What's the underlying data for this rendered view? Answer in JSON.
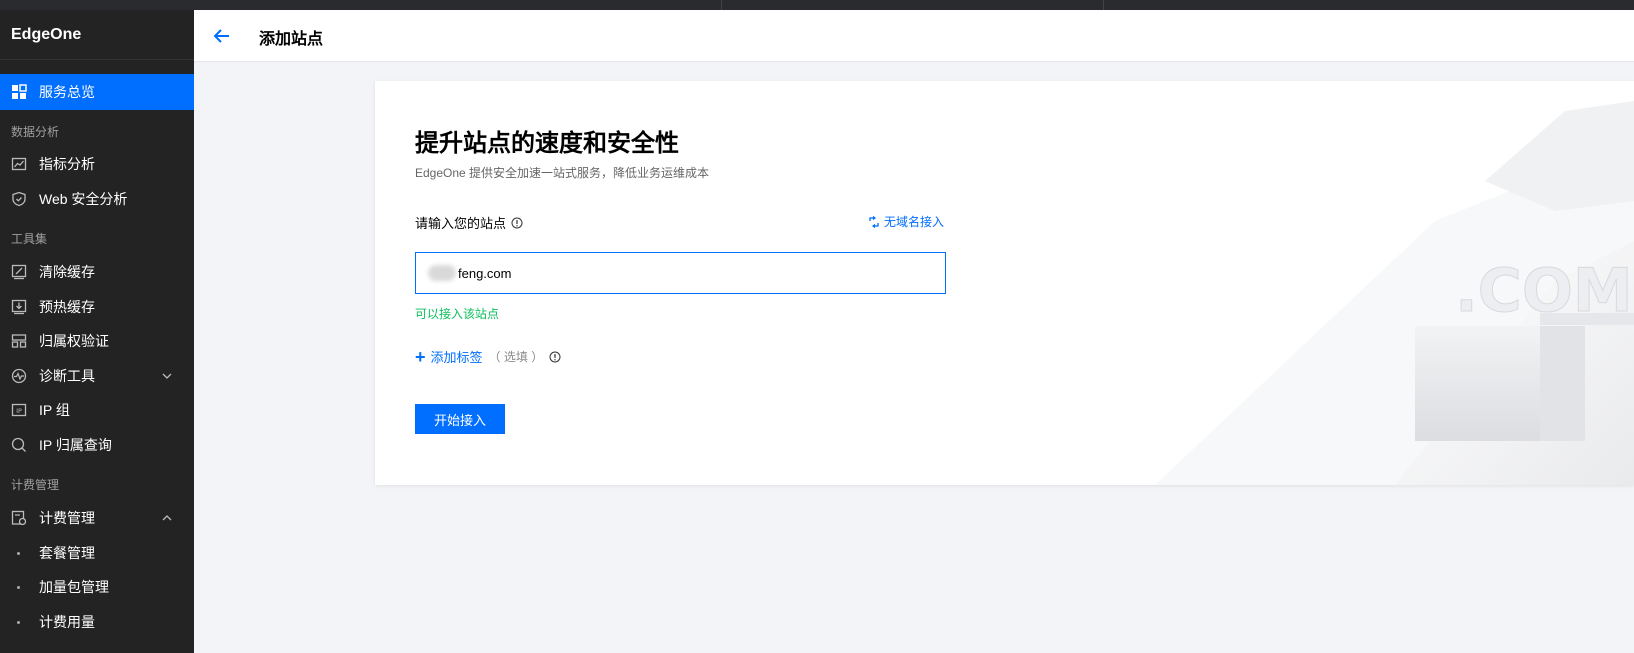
{
  "app": {
    "brand": "EdgeOne"
  },
  "header": {
    "title": "添加站点"
  },
  "sidebar": {
    "items": [
      {
        "label": "服务总览",
        "icon": "grid-icon",
        "active": true
      },
      {
        "section": "数据分析"
      },
      {
        "label": "指标分析",
        "icon": "chart-icon"
      },
      {
        "label": "Web 安全分析",
        "icon": "shield-icon"
      },
      {
        "section": "工具集"
      },
      {
        "label": "清除缓存",
        "icon": "clear-cache-icon"
      },
      {
        "label": "预热缓存",
        "icon": "download-icon"
      },
      {
        "label": "归属权验证",
        "icon": "verify-icon"
      },
      {
        "label": "诊断工具",
        "icon": "pulse-icon",
        "expandable": true,
        "expanded": false
      },
      {
        "label": "IP 组",
        "icon": "ip-icon"
      },
      {
        "label": "IP 归属查询",
        "icon": "search-icon"
      },
      {
        "section": "计费管理"
      },
      {
        "label": "计费管理",
        "icon": "billing-icon",
        "expandable": true,
        "expanded": true
      },
      {
        "label": "套餐管理",
        "sub": true
      },
      {
        "label": "加量包管理",
        "sub": true
      },
      {
        "label": "计费用量",
        "sub": true
      }
    ]
  },
  "card": {
    "heading": "提升站点的速度和安全性",
    "subtitle": "EdgeOne 提供安全加速一站式服务，降低业务运维成本",
    "field_label": "请输入您的站点",
    "switch_link": "无域名接入",
    "input_value": "feng.com",
    "status_message": "可以接入该站点",
    "add_tag_label": "添加标签",
    "optional_label": "（ 选填 ）",
    "start_button": "开始接入",
    "illustration_text": ".COM"
  },
  "colors": {
    "accent": "#006eff",
    "success": "#0abf5b",
    "sidebar_bg": "#232323"
  }
}
